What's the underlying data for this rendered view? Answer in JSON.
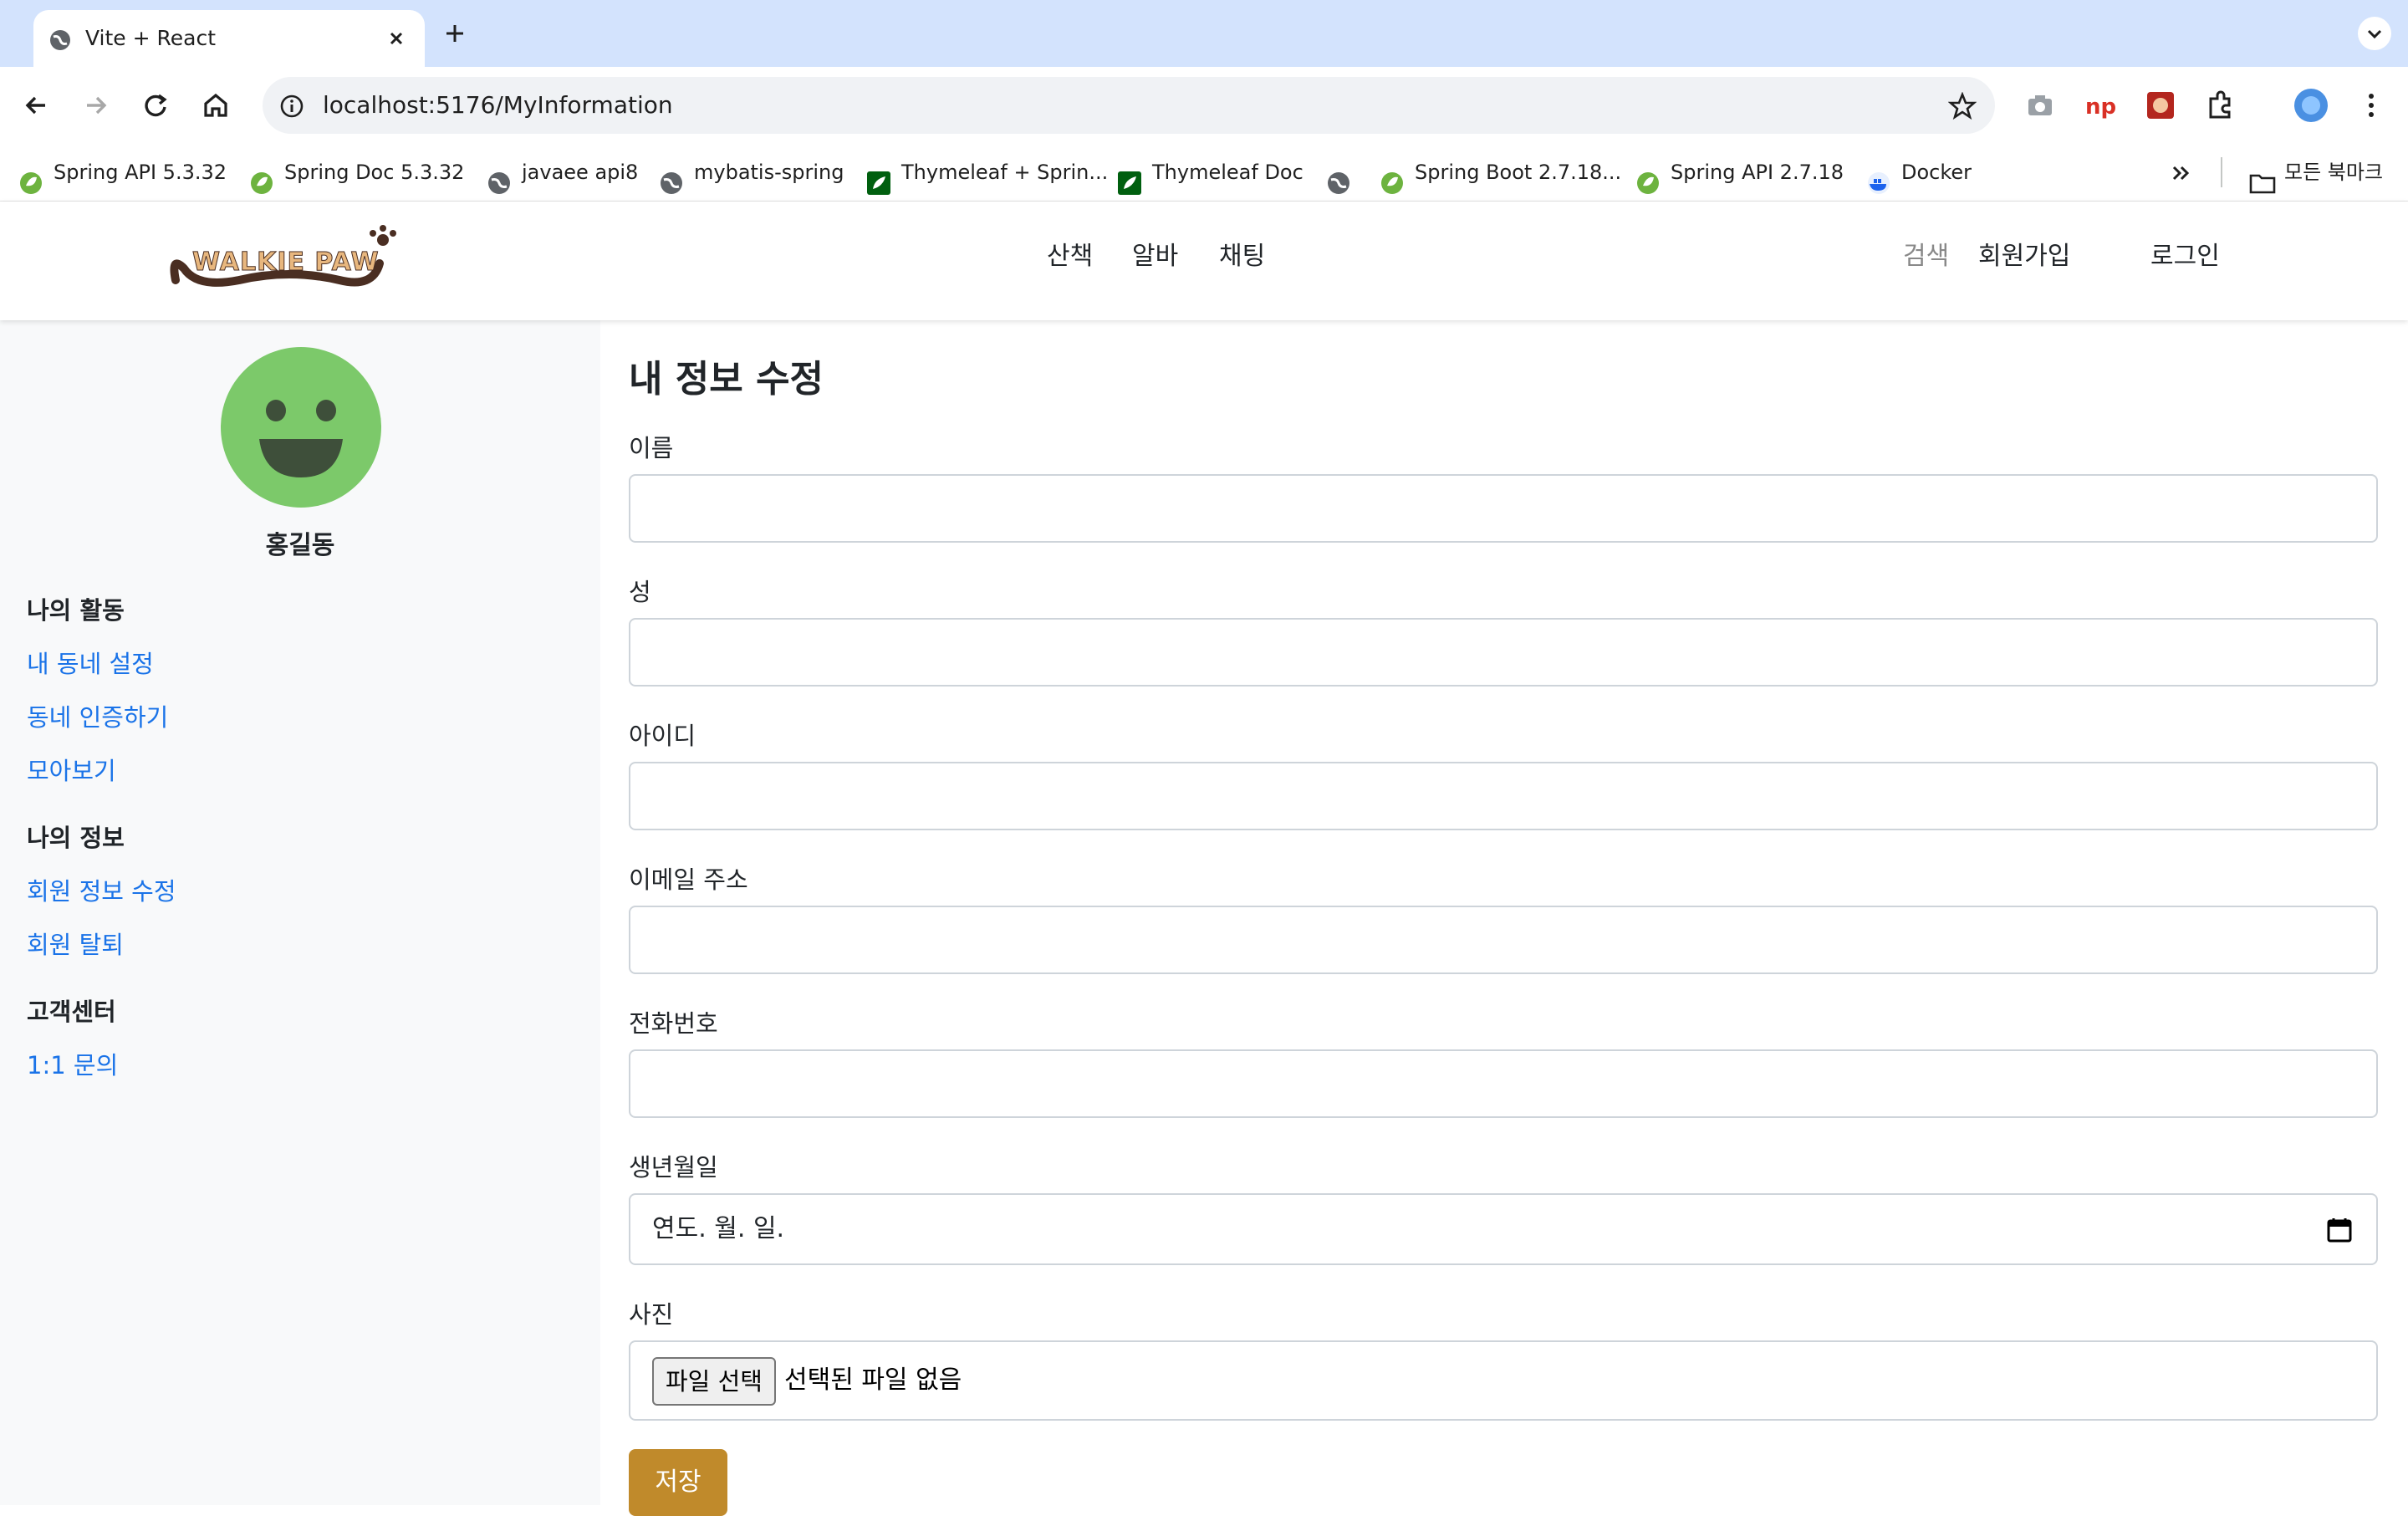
{
  "browser": {
    "tab_title": "Vite + React",
    "url": "localhost:5176/MyInformation",
    "bookmarks": [
      {
        "label": "Spring API 5.3.32",
        "icon": "spring-icon"
      },
      {
        "label": "Spring Doc 5.3.32",
        "icon": "spring-icon"
      },
      {
        "label": "javaee api8",
        "icon": "globe-icon"
      },
      {
        "label": "mybatis-spring",
        "icon": "globe-icon"
      },
      {
        "label": "Thymeleaf + Sprin...",
        "icon": "thymeleaf-icon"
      },
      {
        "label": "Thymeleaf Doc",
        "icon": "thymeleaf-icon"
      },
      {
        "label": "",
        "icon": "globe-icon"
      },
      {
        "label": "Spring Boot 2.7.18...",
        "icon": "spring-icon"
      },
      {
        "label": "Spring API  2.7.18",
        "icon": "spring-icon"
      },
      {
        "label": "Docker",
        "icon": "docker-icon"
      }
    ],
    "all_bookmarks": "모든 북마크"
  },
  "header": {
    "logo_text": "WALKIE PAW",
    "nav": [
      "산책",
      "알바",
      "채팅"
    ],
    "search": "검색",
    "signup": "회원가입",
    "login": "로그인",
    "colors": {
      "search": "#888888",
      "text": "#212529"
    }
  },
  "sidebar": {
    "username": "홍길동",
    "avatar_color": "#7cc96a",
    "sections": [
      {
        "title": "나의 활동",
        "links": [
          "내 동네 설정",
          "동네 인증하기",
          "모아보기"
        ]
      },
      {
        "title": "나의 정보",
        "links": [
          "회원 정보 수정",
          "회원 탈퇴"
        ]
      },
      {
        "title": "고객센터",
        "links": [
          "1:1 문의"
        ]
      }
    ],
    "link_color": "#1a73e8"
  },
  "form": {
    "title": "내 정보 수정",
    "fields": [
      {
        "label": "이름",
        "value": ""
      },
      {
        "label": "성",
        "value": ""
      },
      {
        "label": "아이디",
        "value": ""
      },
      {
        "label": "이메일 주소",
        "value": ""
      },
      {
        "label": "전화번호",
        "value": ""
      }
    ],
    "birth_label": "생년월일",
    "birth_placeholder": "연도. 월. 일.",
    "photo_label": "사진",
    "file_button": "파일 선택",
    "file_status": "선택된 파일 없음",
    "save": "저장",
    "save_color": "#c08a2b"
  }
}
